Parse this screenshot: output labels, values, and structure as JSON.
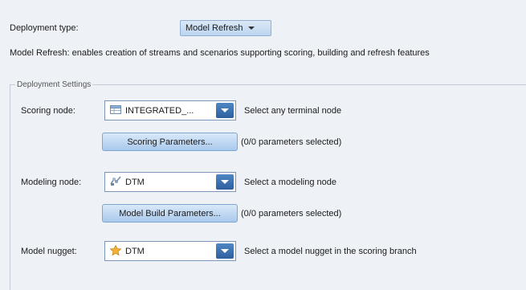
{
  "deployment": {
    "type_label": "Deployment type:",
    "type_value": "Model Refresh",
    "description": "Model Refresh: enables creation of streams and scenarios supporting scoring, building and refresh features"
  },
  "settings": {
    "legend": "Deployment Settings",
    "scoring": {
      "label": "Scoring node:",
      "value": "INTEGRATED_...",
      "hint": "Select any terminal node",
      "button": "Scoring Parameters...",
      "status": "(0/0 parameters selected)"
    },
    "modeling": {
      "label": "Modeling node:",
      "value": "DTM",
      "hint": "Select a modeling node",
      "button": "Model Build Parameters...",
      "status": "(0/0 parameters selected)"
    },
    "nugget": {
      "label": "Model nugget:",
      "value": "DTM",
      "hint": "Select a model nugget in the scoring branch"
    }
  },
  "icons": {
    "scoring_node": "table-node-icon",
    "modeling_node": "model-node-icon",
    "nugget": "nugget-icon"
  }
}
